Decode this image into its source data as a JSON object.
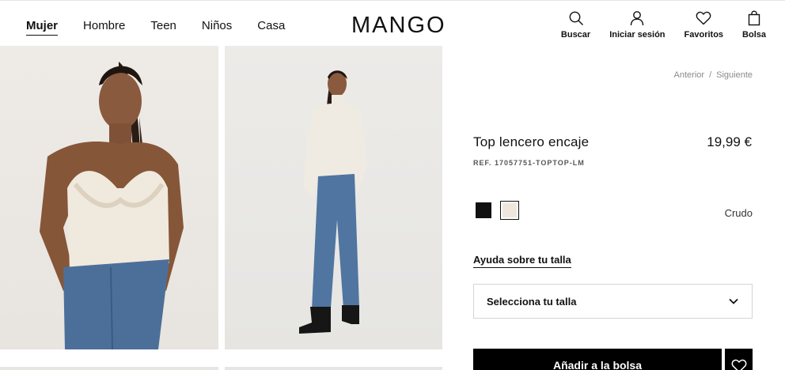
{
  "nav": {
    "items": [
      {
        "label": "Mujer",
        "active": true
      },
      {
        "label": "Hombre",
        "active": false
      },
      {
        "label": "Teen",
        "active": false
      },
      {
        "label": "Niños",
        "active": false
      },
      {
        "label": "Casa",
        "active": false
      }
    ]
  },
  "brand": {
    "logo_text": "MANGO"
  },
  "tools": {
    "search": {
      "label": "Buscar",
      "icon": "search-icon"
    },
    "login": {
      "label": "Iniciar sesión",
      "icon": "user-icon"
    },
    "favorites": {
      "label": "Favoritos",
      "icon": "heart-icon"
    },
    "bag": {
      "label": "Bolsa",
      "icon": "bag-icon"
    }
  },
  "pager": {
    "previous": "Anterior",
    "separator": "/",
    "next": "Siguiente"
  },
  "product": {
    "name": "Top lencero encaje",
    "price": "19,99 €",
    "reference": "REF. 17057751-TOPTOP-LM",
    "colors": [
      {
        "name": "black",
        "hex": "#111111"
      },
      {
        "name": "Crudo",
        "hex": "#efe7dc",
        "selected": true
      }
    ],
    "selected_color_label": "Crudo"
  },
  "size": {
    "help_label": "Ayuda sobre tu talla",
    "select_placeholder": "Selecciona tu talla"
  },
  "actions": {
    "add_to_bag": "Añadir a la bolsa"
  }
}
